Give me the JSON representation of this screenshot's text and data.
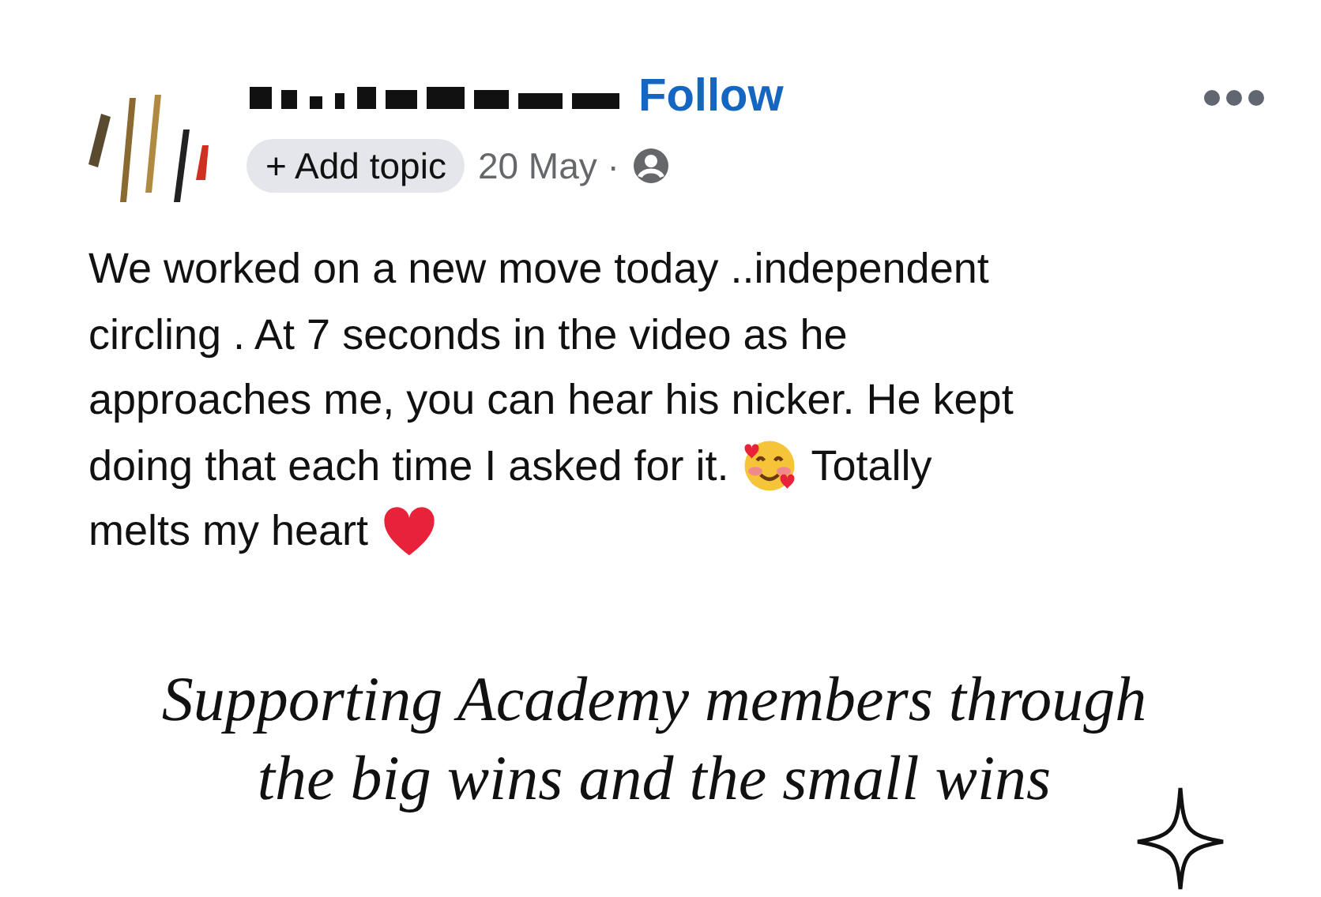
{
  "post": {
    "follow": "Follow",
    "add_topic": "+ Add topic",
    "date": "20 May ·",
    "body_lines": [
      [
        {
          "kind": "text",
          "text": "We worked on a new move today ..independent"
        }
      ],
      [
        {
          "kind": "text",
          "text": "circling . At 7 seconds in the video as he"
        }
      ],
      [
        {
          "kind": "text",
          "text": "approaches me, you can hear his nicker. He kept"
        }
      ],
      [
        {
          "kind": "text",
          "text": "doing that each time I asked for it."
        },
        {
          "kind": "emoji_smile_hearts"
        },
        {
          "kind": "text",
          "text": "Totally"
        }
      ],
      [
        {
          "kind": "text",
          "text": "melts my heart"
        },
        {
          "kind": "emoji_heart"
        }
      ]
    ]
  },
  "caption": {
    "lines": [
      "Supporting Academy members through",
      "the big wins and the small wins"
    ]
  }
}
